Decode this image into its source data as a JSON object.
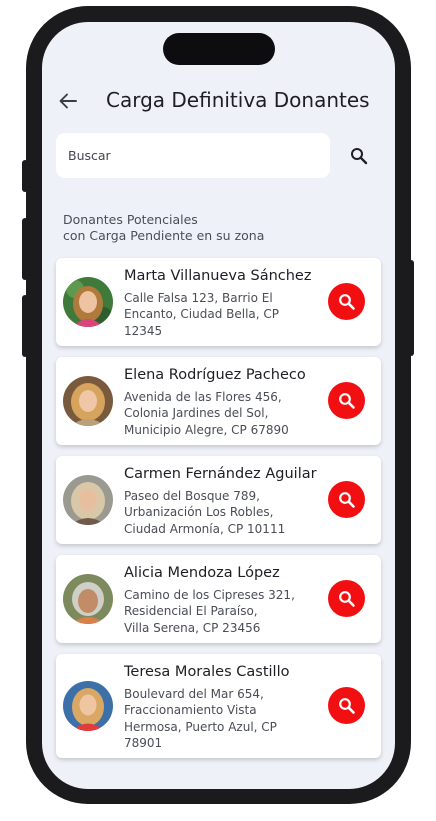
{
  "header": {
    "title": "Carga Definitiva Donantes",
    "back_icon": "arrow-left-icon"
  },
  "search": {
    "placeholder": "Buscar",
    "button_icon": "search-icon"
  },
  "section": {
    "line1": "Donantes Potenciales",
    "line2": "con Carga Pendiente en su zona"
  },
  "donors": [
    {
      "name": "Marta Villanueva Sánchez",
      "address_lines": [
        "Calle Falsa 123, Barrio El",
        "Encanto, Ciudad Bella, CP",
        "12345"
      ],
      "action_icon": "search-icon"
    },
    {
      "name": "Elena Rodríguez Pacheco",
      "address_lines": [
        "Avenida de las Flores 456,",
        "Colonia Jardines del Sol,",
        "Municipio Alegre, CP 67890"
      ],
      "action_icon": "search-icon"
    },
    {
      "name": "Carmen Fernández Aguilar",
      "address_lines": [
        "Paseo del Bosque 789,",
        "Urbanización Los Robles,",
        "Ciudad Armonía, CP 10111"
      ],
      "action_icon": "search-icon"
    },
    {
      "name": "Alicia Mendoza López",
      "address_lines": [
        "Camino de los Cipreses 321,",
        "Residencial El Paraíso,",
        "Villa Serena, CP 23456"
      ],
      "action_icon": "search-icon"
    },
    {
      "name": "Teresa Morales Castillo",
      "address_lines": [
        "Boulevard del Mar 654,",
        "Fraccionamiento Vista",
        "Hermosa, Puerto Azul, CP",
        "78901"
      ],
      "action_icon": "search-icon"
    }
  ],
  "colors": {
    "accent": "#f20f12",
    "screen_background": "#eef2f8",
    "card_background": "#ffffff",
    "text_primary": "#1e1e24",
    "text_secondary": "#4a4d57"
  }
}
